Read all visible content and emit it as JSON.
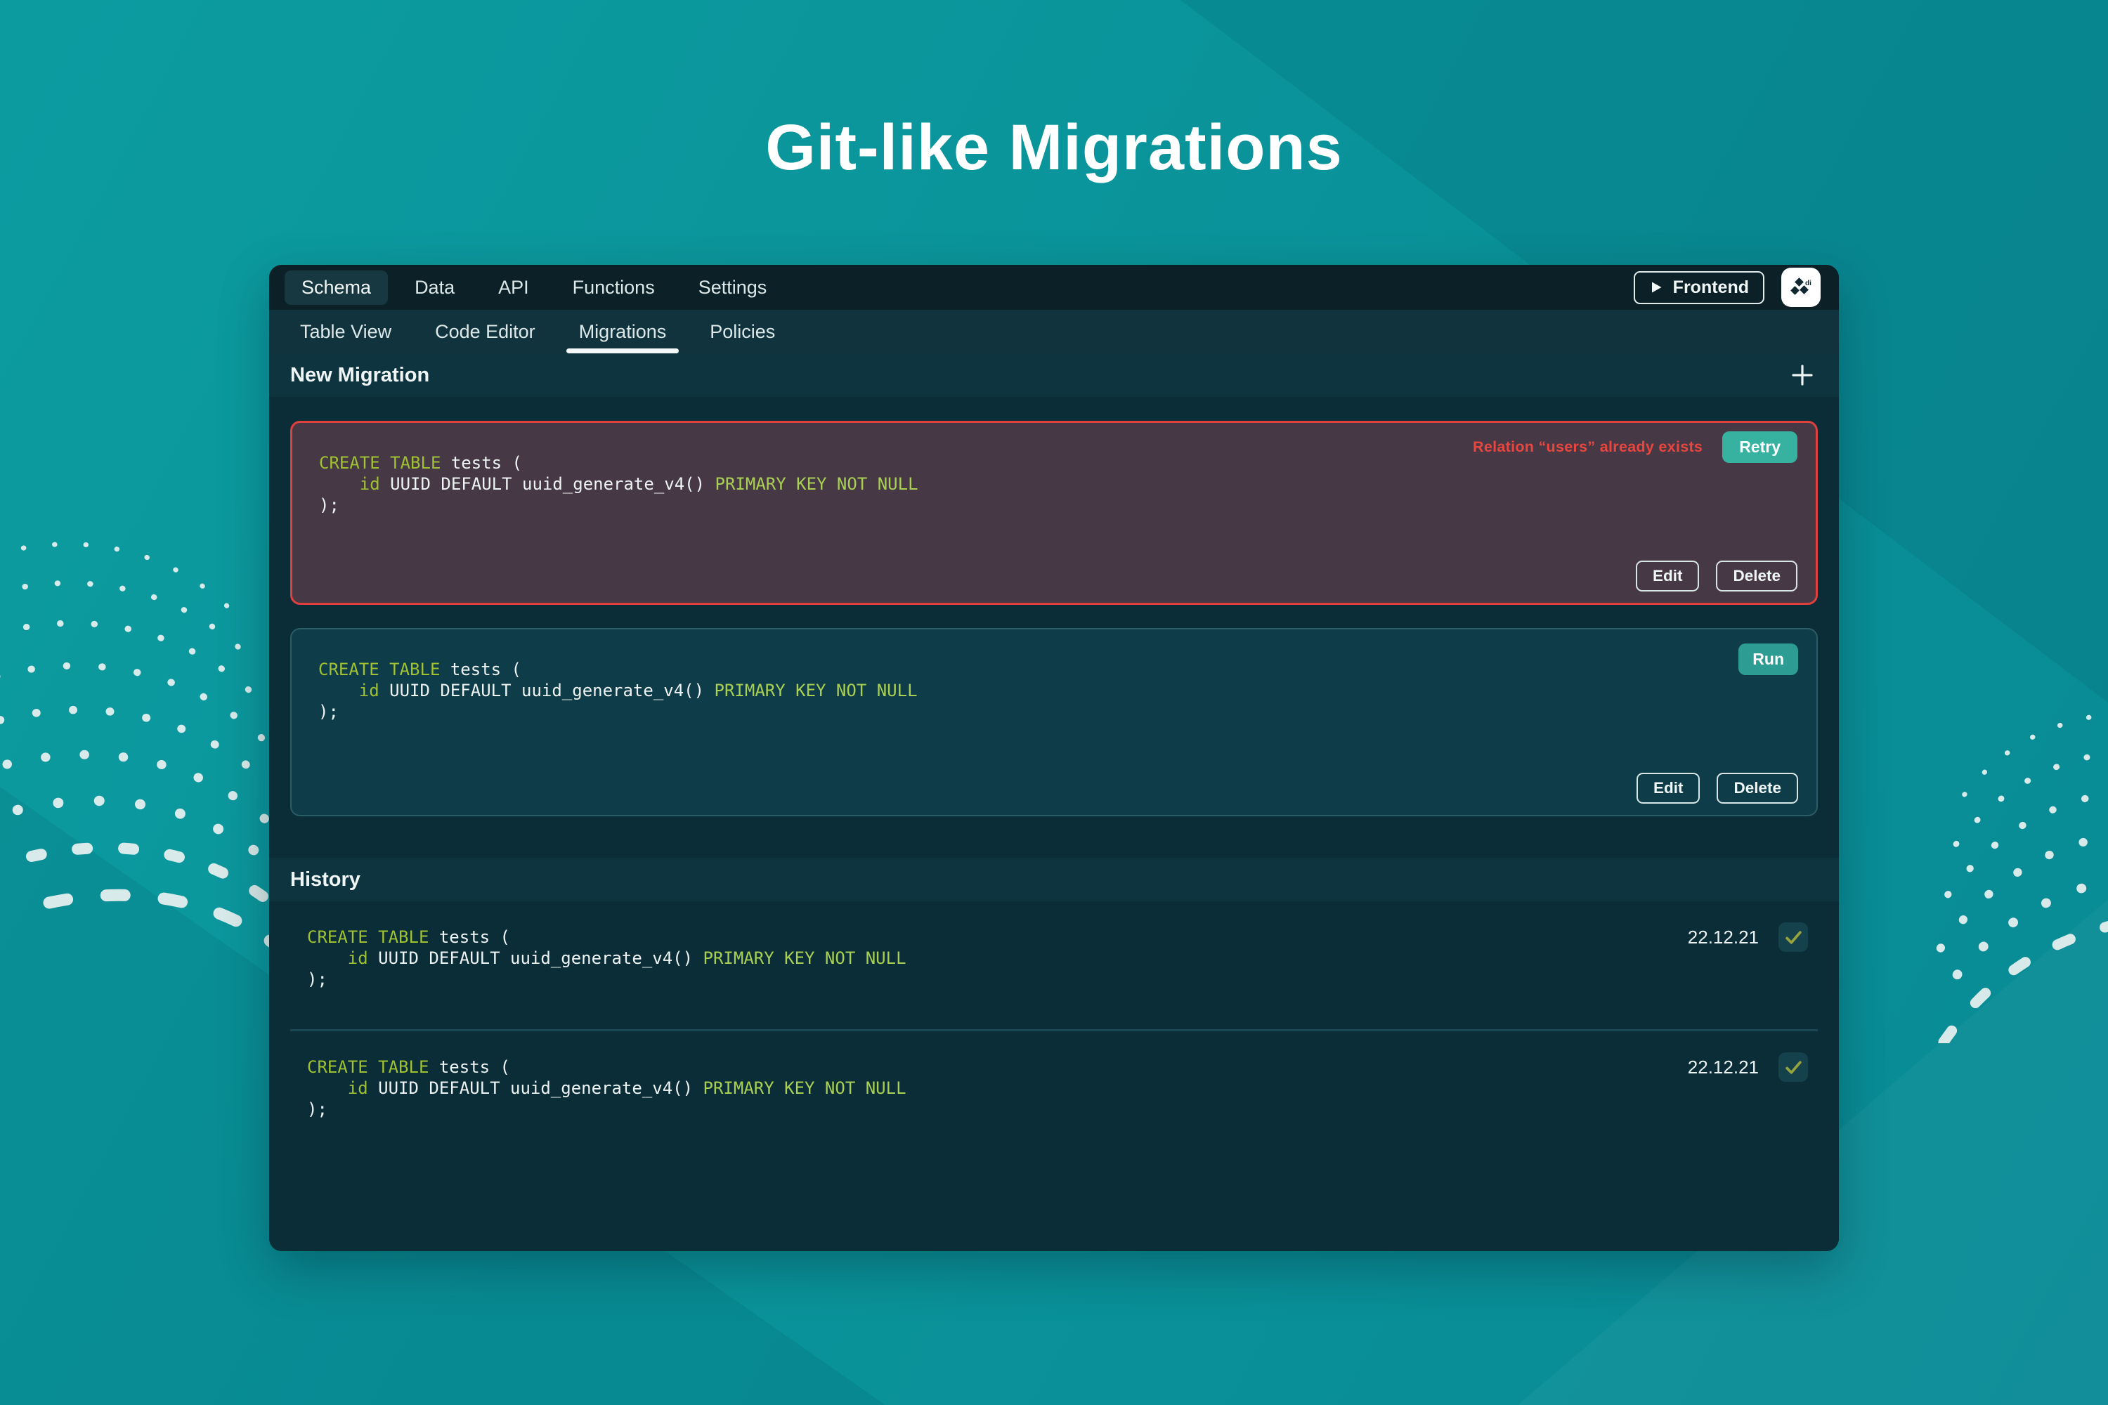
{
  "page": {
    "title": "Git-like Migrations"
  },
  "topnav": {
    "items": [
      {
        "label": "Schema",
        "active": true
      },
      {
        "label": "Data"
      },
      {
        "label": "API"
      },
      {
        "label": "Functions"
      },
      {
        "label": "Settings"
      }
    ],
    "frontend_label": "Frontend",
    "logo_label": "di"
  },
  "subnav": {
    "items": [
      {
        "label": "Table View"
      },
      {
        "label": "Code Editor"
      },
      {
        "label": "Migrations",
        "active": true
      },
      {
        "label": "Policies"
      }
    ]
  },
  "sections": {
    "new_migration": "New Migration",
    "history": "History"
  },
  "sql_lines": [
    [
      {
        "c": "kw",
        "t": "CREATE TABLE"
      },
      {
        "c": "pl",
        "t": " tests ("
      }
    ],
    [
      {
        "c": "pl",
        "t": "    "
      },
      {
        "c": "kw",
        "t": "id"
      },
      {
        "c": "pl",
        "t": " UUID DEFAULT uuid_generate_v4() "
      },
      {
        "c": "kw2",
        "t": "PRIMARY KEY NOT NULL"
      }
    ],
    [
      {
        "c": "pl",
        "t": ");"
      }
    ]
  ],
  "cards": {
    "error": {
      "message": "Relation “users” already exists",
      "retry_label": "Retry",
      "edit_label": "Edit",
      "delete_label": "Delete"
    },
    "pending": {
      "run_label": "Run",
      "edit_label": "Edit",
      "delete_label": "Delete"
    }
  },
  "history": {
    "entries": [
      {
        "date": "22.12.21"
      },
      {
        "date": "22.12.21"
      }
    ]
  },
  "colors": {
    "background_teal": "#0a9197",
    "accent_teal": "#38b2a0",
    "error_red": "#e2403e",
    "code_keyword": "#9fc132",
    "code_keyword_light": "#a9d052",
    "window_bg": "#0a2d37"
  }
}
